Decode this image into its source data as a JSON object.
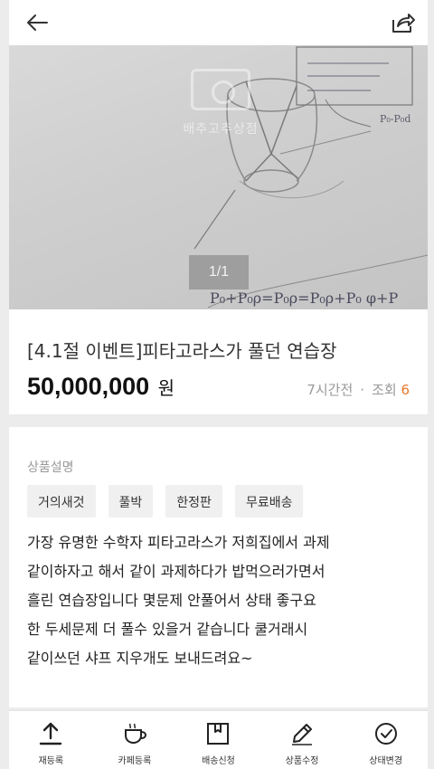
{
  "header": {
    "back_icon": "arrow-left-icon",
    "share_icon": "share-icon"
  },
  "photo": {
    "watermark_text": "배추고추상점",
    "counter": "1/1"
  },
  "item": {
    "title": "[4.1절 이벤트]피타고라스가 풀던 연습장",
    "price": "50,000,000",
    "currency": "원",
    "time_ago": "7시간전",
    "separator": "·",
    "views_label": "조회",
    "views_count": "6"
  },
  "description": {
    "section_label": "상품설명",
    "tags": [
      "거의새것",
      "풀박",
      "한정판",
      "무료배송"
    ],
    "lines": [
      "가장 유명한 수학자 피타고라스가 저희집에서 과제",
      "같이하자고 해서 같이 과제하다가 밥먹으러가면서",
      "흘린 연습장입니다 몇문제 안풀어서 상태 좋구요",
      "한 두세문제 더 풀수 있을거 같습니다 쿨거래시",
      "같이쓰던 샤프 지우개도 보내드려요~"
    ]
  },
  "bottom_nav": [
    {
      "label": "재등록",
      "icon": "upload-icon"
    },
    {
      "label": "카페등록",
      "icon": "coffee-cup-icon"
    },
    {
      "label": "배송신청",
      "icon": "box-icon"
    },
    {
      "label": "상품수정",
      "icon": "pencil-icon"
    },
    {
      "label": "상태변경",
      "icon": "check-circle-icon"
    }
  ],
  "colors": {
    "accent": "#e8762b",
    "background": "#ececec",
    "card": "#ffffff"
  }
}
